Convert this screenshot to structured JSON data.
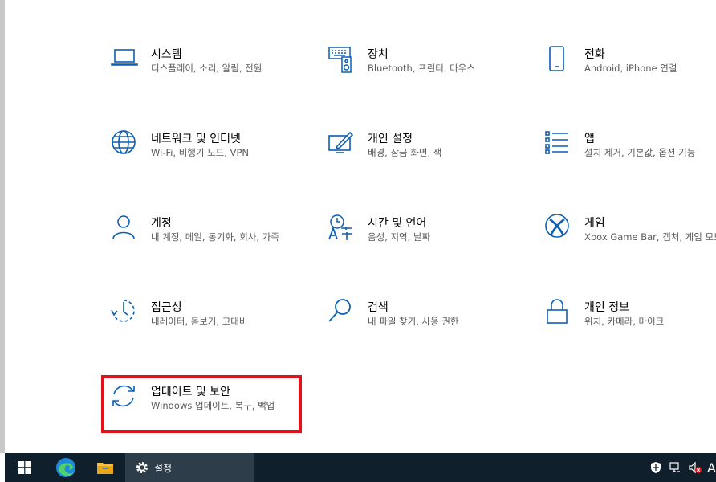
{
  "tiles": [
    {
      "name": "system",
      "title": "시스템",
      "desc": "디스플레이, 소리, 알림, 전원",
      "icon": "laptop-icon"
    },
    {
      "name": "devices",
      "title": "장치",
      "desc": "Bluetooth, 프린터, 마우스",
      "icon": "keyboard-speaker-icon"
    },
    {
      "name": "phone",
      "title": "전화",
      "desc": "Android, iPhone 연결",
      "icon": "phone-icon"
    },
    {
      "name": "network",
      "title": "네트워크 및 인터넷",
      "desc": "Wi-Fi, 비행기 모드, VPN",
      "icon": "globe-icon"
    },
    {
      "name": "personalization",
      "title": "개인 설정",
      "desc": "배경, 잠금 화면, 색",
      "icon": "pen-display-icon"
    },
    {
      "name": "apps",
      "title": "앱",
      "desc": "설치 제거, 기본값, 옵션 기능",
      "icon": "app-list-icon"
    },
    {
      "name": "accounts",
      "title": "계정",
      "desc": "내 계정, 메일, 동기화, 회사, 가족",
      "icon": "person-icon"
    },
    {
      "name": "time-language",
      "title": "시간 및 언어",
      "desc": "음성, 지역, 날짜",
      "icon": "clock-language-icon"
    },
    {
      "name": "gaming",
      "title": "게임",
      "desc": "Xbox Game Bar, 캡처, 게임 모드",
      "icon": "xbox-icon"
    },
    {
      "name": "ease-of-access",
      "title": "접근성",
      "desc": "내레이터, 돋보기, 고대비",
      "icon": "ease-of-access-icon"
    },
    {
      "name": "search",
      "title": "검색",
      "desc": "내 파일 찾기, 사용 권한",
      "icon": "magnifier-icon"
    },
    {
      "name": "privacy",
      "title": "개인 정보",
      "desc": "위치, 카메라, 마이크",
      "icon": "lock-icon"
    },
    {
      "name": "update-security",
      "title": "업데이트 및 보안",
      "desc": "Windows 업데이트, 복구, 백업",
      "icon": "sync-icon"
    }
  ],
  "taskbar": {
    "settings_label": "설정",
    "tray_text": "A"
  },
  "colors": {
    "icon": "#0b5fb5",
    "highlight": "#e0131b",
    "taskbar": "#0f1f2c"
  }
}
